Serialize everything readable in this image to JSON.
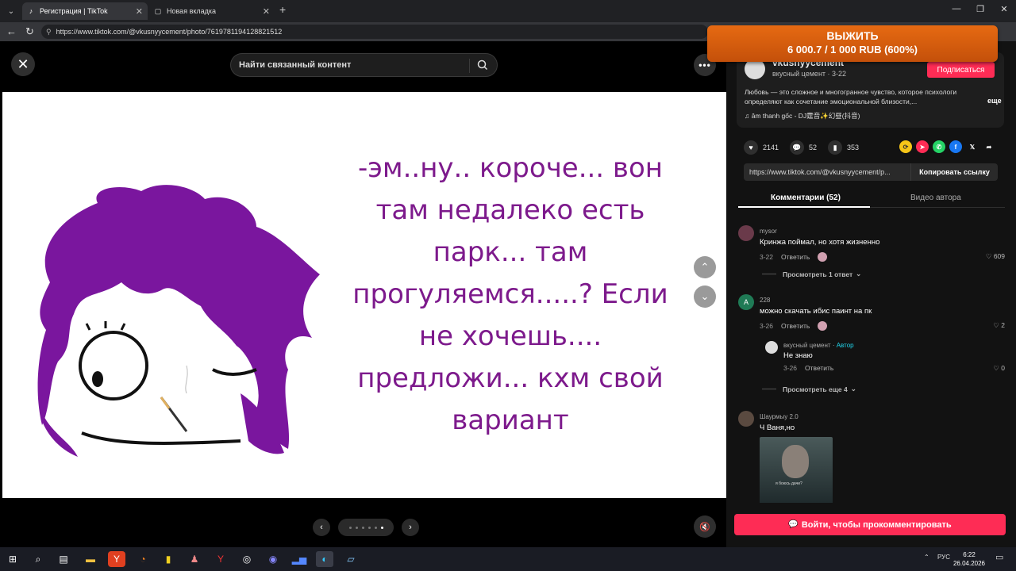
{
  "browser": {
    "tabs": [
      {
        "title": "Регистрация | TikTok",
        "active": true
      },
      {
        "title": "Новая вкладка",
        "active": false
      }
    ],
    "url": "https://www.tiktok.com/@vkusnyycement/photo/7619781194128821512"
  },
  "promo": {
    "line1": "ВЫЖИТЬ",
    "line2": "6 000.7 / 1 000 RUB (600%)"
  },
  "viewer": {
    "search_placeholder": "Найти связанный контент",
    "photo_text_lines": [
      "-эм..ну.. короче... вон",
      "там недалеко есть",
      "парк... там",
      "прогуляемся.....? Если",
      "не хочешь....",
      "предложи... кхм свой",
      "вариант"
    ],
    "colors": {
      "text": "#7d1a8c",
      "hair": "#7a169e"
    },
    "pager": {
      "total": 6,
      "current": 6
    }
  },
  "post": {
    "author_handle": "vkusnyycement",
    "author_sub": "вкусный цемент · 3-22",
    "follow_label": "Подписаться",
    "description": "Любовь — это сложное и многогранное чувство, которое психологи определяют как сочетание эмоциональной близости,...",
    "more_label": "еще",
    "music": "âm thanh gốc - DJ霆音✨幻昼(抖音)",
    "likes": "2141",
    "comments": "52",
    "saves": "353",
    "link": "https://www.tiktok.com/@vkusnyycement/p...",
    "copy_label": "Копировать ссылку"
  },
  "tabs": {
    "comments_label": "Комментарии (52)",
    "author_videos_label": "Видео автора"
  },
  "comments": [
    {
      "name": "mysor",
      "text": "Кринжа поймал, но хотя жизненно",
      "date": "3-22",
      "reply_label": "Ответить",
      "likes": "609",
      "view_replies": "Просмотреть 1 ответ"
    },
    {
      "name": "228",
      "avatar_letter": "A",
      "text": "можно скачать ибис паинт на пк",
      "date": "3-26",
      "reply_label": "Ответить",
      "likes": "2",
      "reply": {
        "name": "вкусный цемент",
        "author_tag": "Автор",
        "text": "Не знаю",
        "date": "3-26",
        "reply_label": "Ответить",
        "likes": "0"
      },
      "view_more": "Просмотреть еще 4"
    },
    {
      "name": "Шаурмыу 2.0",
      "text": "Ч Ваня,но",
      "image_caption": "я боюсь дачи?"
    }
  ],
  "login_label": "Войти, чтобы прокомментировать",
  "taskbar": {
    "lang": "РУС",
    "time": "6:22",
    "date": "26.04.2026"
  }
}
